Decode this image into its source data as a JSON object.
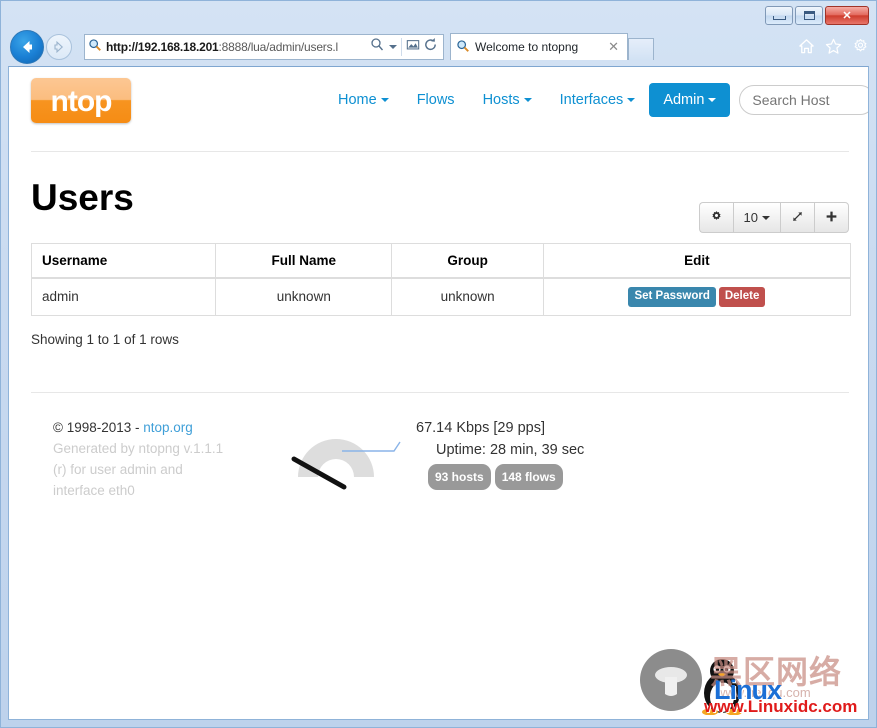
{
  "browser": {
    "window_controls": {
      "minimize": "minimize-button",
      "maximize": "maximize-button",
      "close_label": "✕"
    },
    "address": {
      "scheme": "http://",
      "host": "192.168.18.201",
      "path": ":8888/lua/admin/users.l",
      "full": "http://192.168.18.201:8888/lua/admin/users.l"
    },
    "tab": {
      "title": "Welcome to ntopng",
      "close_label": "✕"
    },
    "toolbar_icons": [
      "home-icon",
      "favorites-star-icon",
      "tools-gear-icon"
    ],
    "nav_icons": [
      "back-icon",
      "forward-icon",
      "search-dropdown-icon",
      "compatibility-view-icon",
      "refresh-icon"
    ]
  },
  "site": {
    "logo_text": "ntop",
    "nav": [
      {
        "label": "Home",
        "caret": true,
        "active": false
      },
      {
        "label": "Flows",
        "caret": false,
        "active": false
      },
      {
        "label": "Hosts",
        "caret": true,
        "active": false
      },
      {
        "label": "Interfaces",
        "caret": true,
        "active": false
      },
      {
        "label": "Admin",
        "caret": true,
        "active": true
      }
    ],
    "search": {
      "placeholder": "Search Host",
      "value": ""
    },
    "accent_color": "#0e90d2",
    "logo_color": "#f79420"
  },
  "main": {
    "title": "Users",
    "toolbar": {
      "settings_icon": "gear-icon",
      "page_size": "10",
      "page_size_caret": "▾",
      "expand_icon": "expand-arrows-icon",
      "add_icon": "plus-icon"
    },
    "table": {
      "columns": [
        "Username",
        "Full Name",
        "Group",
        "Edit"
      ],
      "rows": [
        {
          "username": "admin",
          "full_name": "unknown",
          "group": "unknown",
          "actions": [
            {
              "label": "Set Password",
              "style": "primary",
              "color": "#3a87ad"
            },
            {
              "label": "Delete",
              "style": "danger",
              "color": "#c0504d"
            }
          ]
        }
      ]
    },
    "showing": "Showing 1 to 1 of 1 rows"
  },
  "footer": {
    "copyright": "© 1998-2013 - ",
    "link": "ntop.org",
    "generated_line1": "Generated by ntopng v.1.1.1",
    "generated_line2": "(r) for user admin and",
    "generated_line3": "interface eth0",
    "throughput": "67.14 Kbps [29 pps]",
    "uptime": "Uptime: 28 min, 39 sec",
    "badges": [
      "93 hosts",
      "148 flows"
    ],
    "gauge_icon": "speed-gauge-icon"
  },
  "watermark": {
    "cn_text": "黑区网络",
    "brand": "Linux",
    "ghost_text": "www.hei qu.com",
    "url": "www.Linuxidc.com"
  }
}
